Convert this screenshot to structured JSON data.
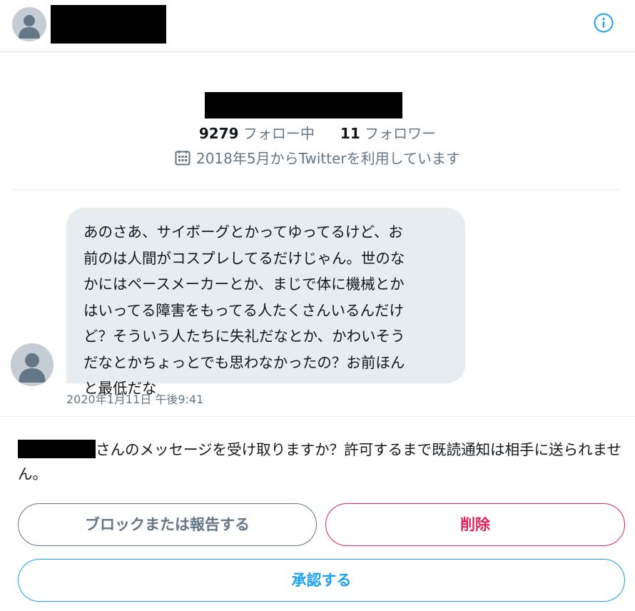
{
  "header": {
    "avatar_icon": "default-avatar-icon",
    "info_icon": "info-circle-icon"
  },
  "profile": {
    "following_count": "9279",
    "following_label": "フォロー中",
    "followers_count": "11",
    "followers_label": "フォロワー",
    "calendar_icon": "calendar-icon",
    "joined_text": "2018年5月からTwitterを利用しています"
  },
  "message": {
    "lines": [
      "あのさあ、サイボーグとかってゆってるけど、お",
      "前のは人間がコスプレしてるだけじゃん。世のな",
      "かにはペースメーカーとか、まじで体に機械とか",
      "はいってる障害をもってる人たくさんいるんだけ",
      "ど？そういう人たちに失礼だなとか、かわいそう",
      "だなとかちょっとでも思わなかったの？お前ほん",
      "と最低だな"
    ],
    "timestamp": "2020年1月11日 午後9:41"
  },
  "request": {
    "text": "さんのメッセージを受け取りますか？許可するまで既読通知は相手に送られません。",
    "block_label": "ブロックまたは報告する",
    "delete_label": "削除",
    "accept_label": "承認する"
  },
  "colors": {
    "accent_blue": "#1da1f2",
    "danger_red": "#e0245e",
    "secondary_text": "#657786",
    "bubble_bg": "#e6ecf0"
  }
}
